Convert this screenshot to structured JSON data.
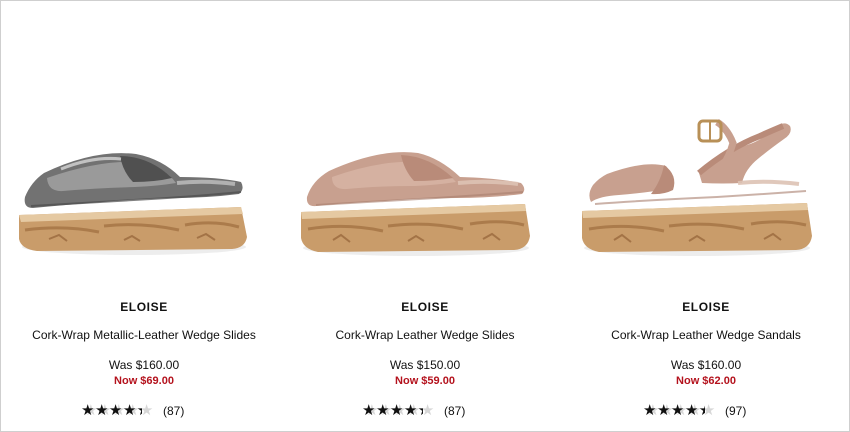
{
  "products": [
    {
      "brand": "ELOISE",
      "name": "Cork-Wrap Metallic-Leather Wedge Slides",
      "was": "Was $160.00",
      "now": "Now $69.00",
      "rating": 0.8,
      "rating_count": "(87)",
      "upper_color": "#6e6e6e",
      "sole_color": "#c99c6a"
    },
    {
      "brand": "ELOISE",
      "name": "Cork-Wrap Leather Wedge Slides",
      "was": "Was $150.00",
      "now": "Now $59.00",
      "rating": 0.8,
      "rating_count": "(87)",
      "upper_color": "#c8a08f",
      "sole_color": "#c99c6a"
    },
    {
      "brand": "ELOISE",
      "name": "Cork-Wrap Leather Wedge Sandals",
      "was": "Was $160.00",
      "now": "Now $62.00",
      "rating": 0.82,
      "rating_count": "(97)",
      "upper_color": "#c8a08f",
      "sole_color": "#c99c6a"
    }
  ],
  "colors": {
    "sale_red": "#b4121d",
    "star_filled": "#111111",
    "star_empty": "#d7d7d7"
  }
}
